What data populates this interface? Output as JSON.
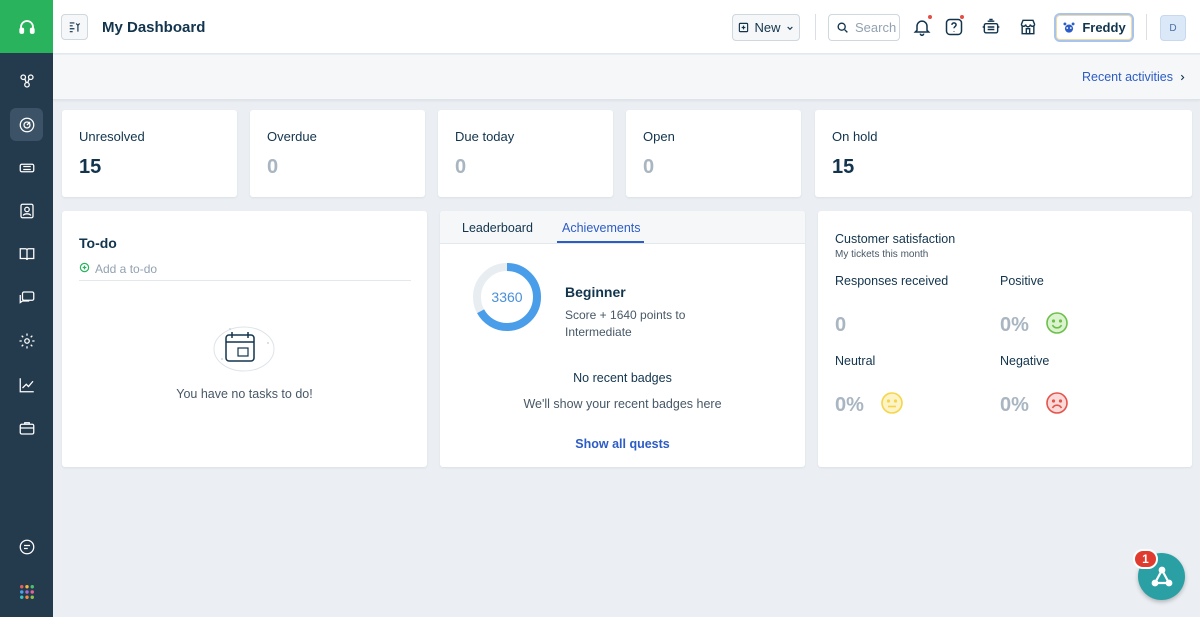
{
  "header": {
    "title": "My Dashboard",
    "new_label": "New",
    "search_placeholder": "Search",
    "freddy_label": "Freddy",
    "avatar_initial": "D"
  },
  "subbar": {
    "recent_activities": "Recent activities"
  },
  "stats": [
    {
      "label": "Unresolved",
      "value": "15"
    },
    {
      "label": "Overdue",
      "value": "0"
    },
    {
      "label": "Due today",
      "value": "0"
    },
    {
      "label": "Open",
      "value": "0"
    },
    {
      "label": "On hold",
      "value": "15"
    }
  ],
  "todo": {
    "title": "To-do",
    "add_placeholder": "Add a to-do",
    "empty_text": "You have no tasks to do!"
  },
  "achievements": {
    "tabs": [
      "Leaderboard",
      "Achievements"
    ],
    "active_tab": "Achievements",
    "score": "3360",
    "level": "Beginner",
    "next_level_text": "Score + 1640 points to Intermediate",
    "progress_fraction": 0.67,
    "badges_title": "No recent badges",
    "badges_sub": "We'll show your recent badges here",
    "quests_link": "Show all quests"
  },
  "csat": {
    "title": "Customer satisfaction",
    "subtitle": "My tickets this month",
    "responses_label": "Responses received",
    "responses_value": "0",
    "positive_label": "Positive",
    "positive_value": "0%",
    "neutral_label": "Neutral",
    "neutral_value": "0%",
    "negative_label": "Negative",
    "negative_value": "0%"
  },
  "widget": {
    "badge_count": "1"
  },
  "colors": {
    "sidebar": "#243a4d",
    "brand_green": "#29b35c",
    "link_blue": "#2c5cc5",
    "ring_blue": "#4a9de8",
    "positive_green": "#6cc04a",
    "neutral_yellow": "#f5d54a",
    "negative_red": "#e5534b"
  },
  "sidebar_icons": [
    "headset-icon",
    "network-icon",
    "dashboard-icon",
    "ticket-icon",
    "contacts-icon",
    "book-icon",
    "chat-icon",
    "gear-icon",
    "analytics-icon",
    "briefcase-icon",
    "chat-bubble-icon",
    "apps-grid-icon"
  ]
}
